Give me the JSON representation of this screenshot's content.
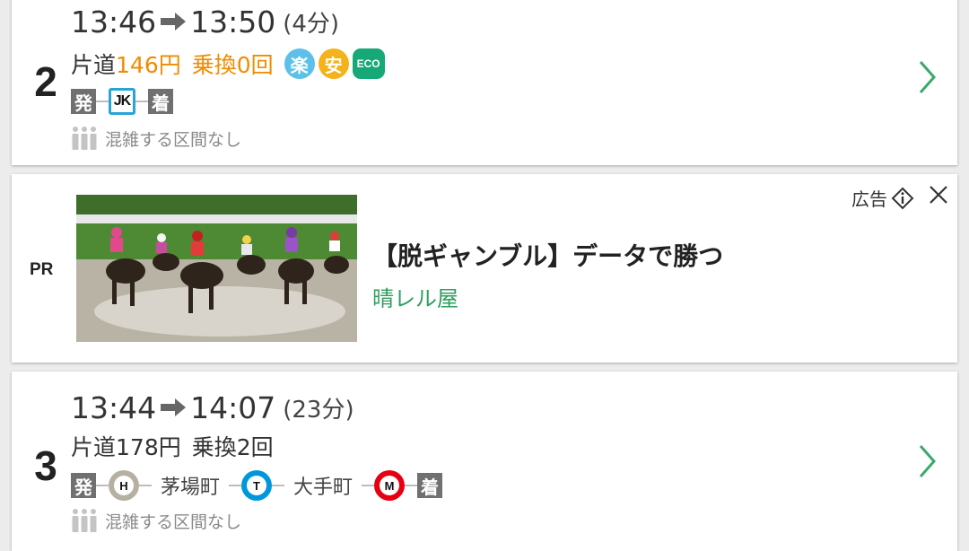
{
  "routes": [
    {
      "number": "2",
      "depart_time": "13:46",
      "arrive_time": "13:50",
      "duration": "(4分)",
      "fare_label": "片道",
      "fare": "146円",
      "transfers": "乗換0回",
      "badges": [
        "楽",
        "安",
        "ECO"
      ],
      "path": {
        "start": "発",
        "line": "JK",
        "end": "着"
      },
      "crowd_text": "混雑する区間なし"
    },
    {
      "number": "3",
      "depart_time": "13:44",
      "arrive_time": "14:07",
      "duration": "(23分)",
      "fare_label": "片道",
      "fare": "178円",
      "transfers": "乗換2回",
      "path": {
        "start": "発",
        "lines": [
          {
            "symbol": "H",
            "color": "#b5b0a1",
            "station": "茅場町"
          },
          {
            "symbol": "T",
            "color": "#0097db",
            "station": "大手町"
          },
          {
            "symbol": "M",
            "color": "#e60012"
          }
        ],
        "end": "着"
      },
      "crowd_text": "混雑する区間なし"
    }
  ],
  "ad": {
    "pr_label": "PR",
    "title": "【脱ギャンブル】データで勝つ",
    "brand": "晴レル屋",
    "ad_label": "広告",
    "image_icon": "horse-race-photo"
  },
  "colors": {
    "accent_orange": "#f08c00",
    "brand_green": "#2e9e5f",
    "chevron_green": "#3aa86b",
    "jk_line": "#2aa3d6"
  }
}
